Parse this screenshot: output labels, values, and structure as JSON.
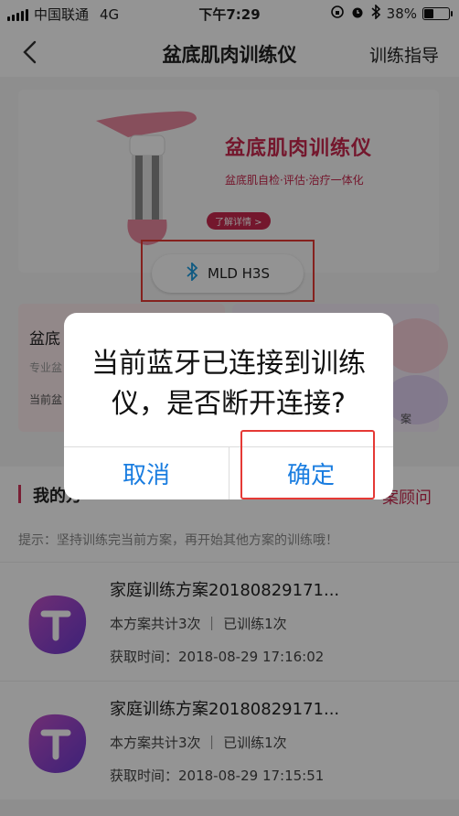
{
  "status_bar": {
    "carrier": "中国联通",
    "network": "4G",
    "time": "下午7:29",
    "battery": "38%",
    "battery_level": 0.38
  },
  "nav": {
    "title": "盆底肌肉训练仪",
    "guide": "训练指导"
  },
  "banner": {
    "title": "盆底肌肉训练仪",
    "subtitle": "盆底肌自检·评估·治疗一体化",
    "detail_button": "了解详情 >"
  },
  "device_button": {
    "name": "MLD H3S"
  },
  "cards": {
    "left_title": "盆底",
    "left_sub": "专业盆",
    "left_current": "当前盆",
    "right_title": "",
    "right_tag": "案"
  },
  "section": {
    "title": "我的方",
    "advisor": "案顾问"
  },
  "tip": "提示：坚持训练完当前方案，再开始其他方案的训练哦！",
  "plans": [
    {
      "title": "家庭训练方案20180829171...",
      "meta": "本方案共计3次 ｜ 已训练1次",
      "time": "获取时间：2018-08-29 17:16:02"
    },
    {
      "title": "家庭训练方案20180829171...",
      "meta": "本方案共计3次 ｜ 已训练1次",
      "time": "获取时间：2018-08-29 17:15:51"
    }
  ],
  "dialog": {
    "message": "当前蓝牙已连接到训练仪，是否断开连接?",
    "cancel": "取消",
    "confirm": "确定"
  },
  "colors": {
    "accent": "#c8284e",
    "link_blue": "#1a7de0",
    "highlight_red": "#e53935"
  }
}
